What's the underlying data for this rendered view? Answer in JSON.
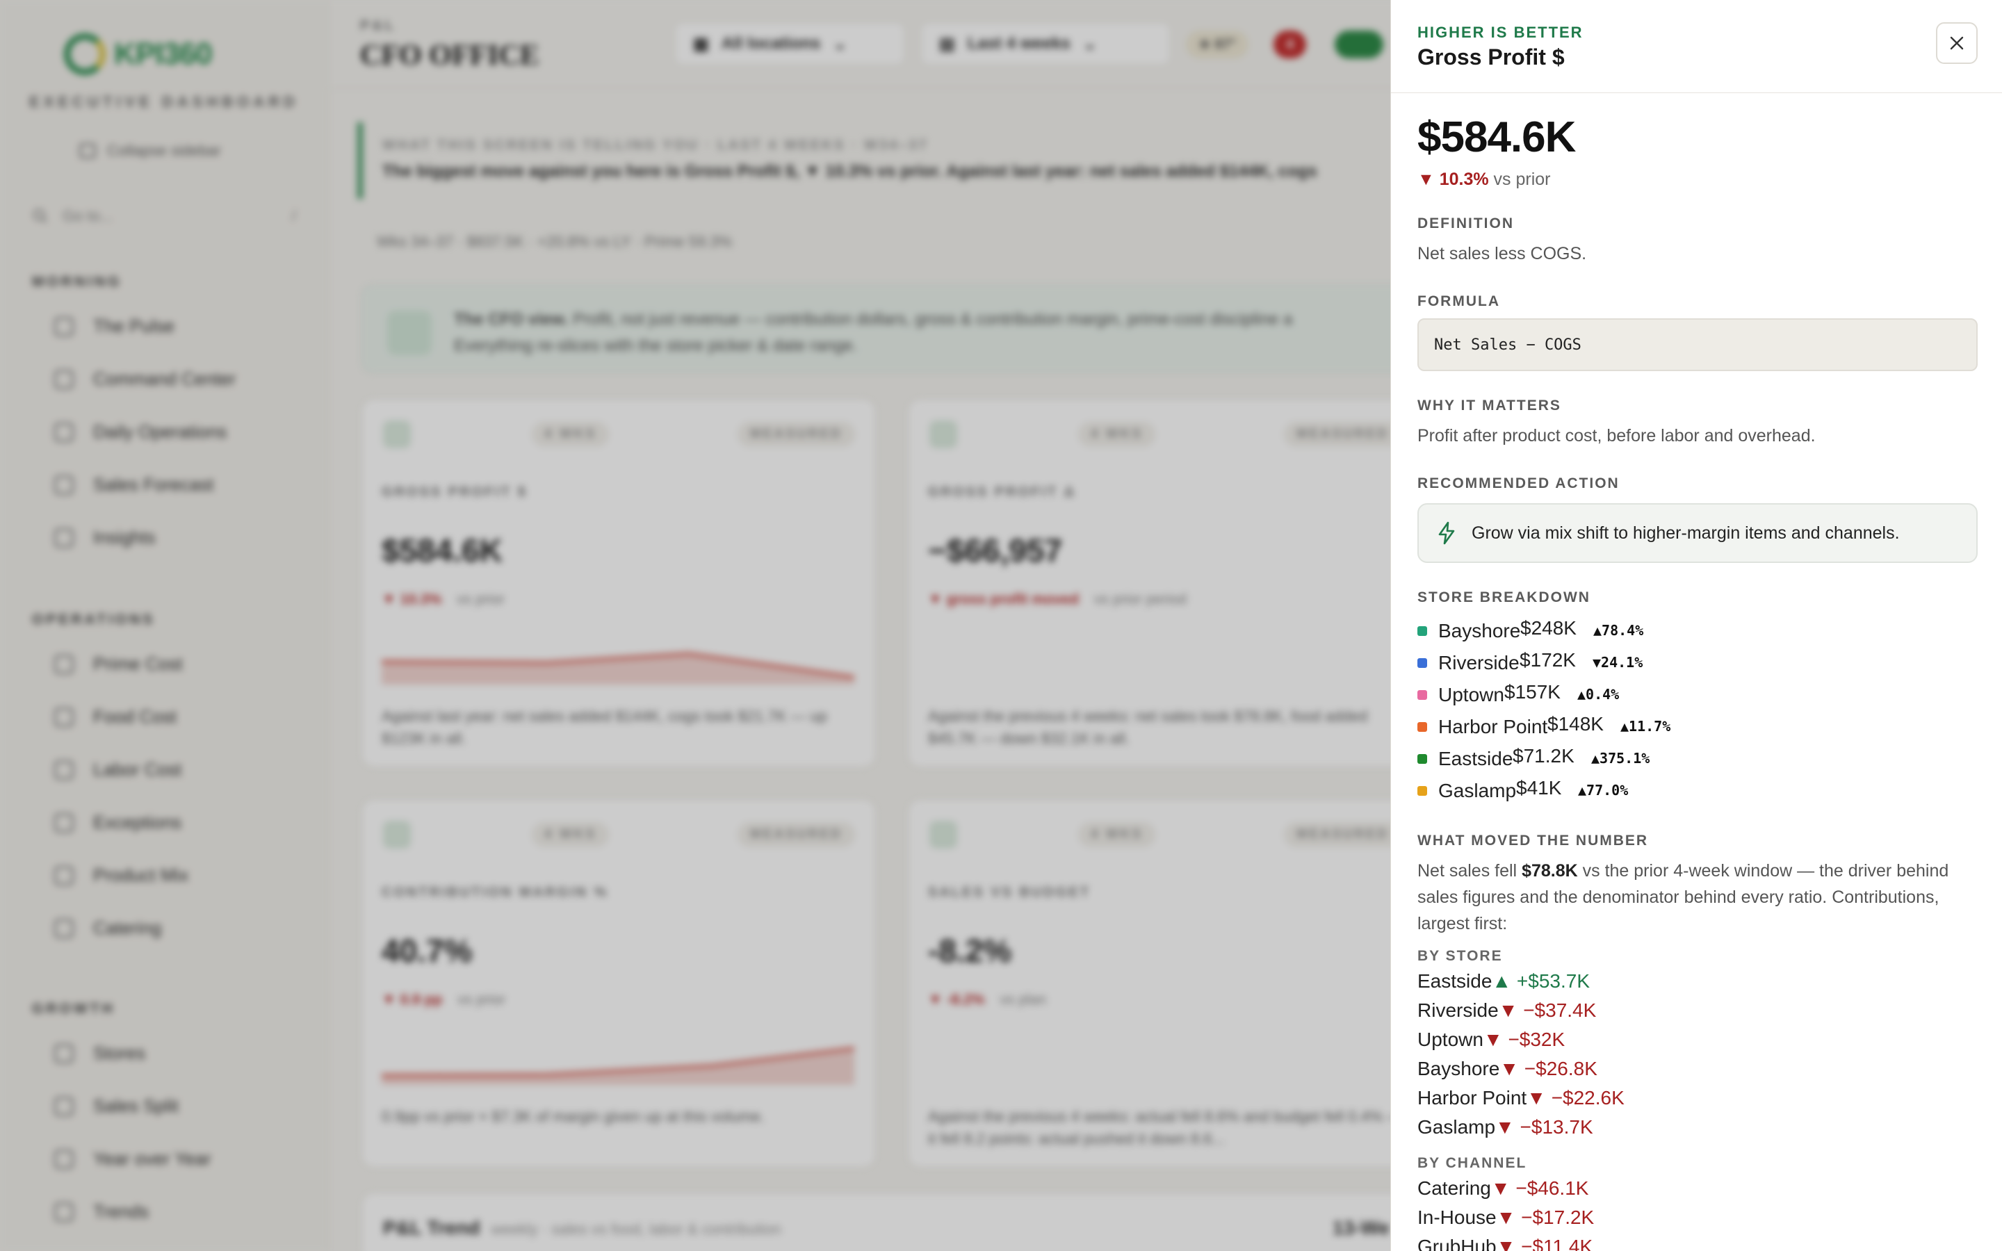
{
  "app": {
    "logo_text": "KPI360",
    "logo_sub": "EXECUTIVE DASHBOARD",
    "collapse_label": "Collapse sidebar",
    "goto_placeholder": "Go to...",
    "goto_shortcut": "/",
    "sections": [
      {
        "label": "MORNING",
        "items": [
          "The Pulse",
          "Command Center",
          "Daily Operations",
          "Sales Forecast",
          "Insights"
        ]
      },
      {
        "label": "OPERATIONS",
        "items": [
          "Prime Cost",
          "Food Cost",
          "Labor Cost",
          "Exceptions",
          "Product Mix",
          "Catering"
        ]
      },
      {
        "label": "GROWTH",
        "items": [
          "Stores",
          "Sales Split",
          "Year over Year",
          "Trends"
        ]
      }
    ],
    "breadcrumb": "P&L",
    "page_title": "CFO OFFICE",
    "location_filter": "All locations",
    "date_filter": "Last 4 weeks",
    "score_badge": "87°",
    "alert_badge": "4",
    "banner_eyebrow": "WHAT THIS SCREEN IS TELLING YOU · LAST 4 WEEKS · W34–37",
    "banner_text": "The biggest move against you here is Gross Profit $, ▼ 10.3% vs prior. Against last year: net sales added $144K, cogs",
    "stats_line": "Wks 34–37 · $837.5K · +20.8% vs LY · Prime 59.3%",
    "cfo_title": "The CFO view.",
    "cfo_text": "Profit, not just revenue — contribution dollars, gross & contribution margin, prime-cost discipline a",
    "cfo_text2": "Everything re-slices with the store picker & date range.",
    "cards": [
      {
        "period": "4 WKS",
        "status": "MEASURED",
        "label": "GROSS PROFIT $",
        "value": "$584.6K",
        "change": "▼ 10.3%",
        "change_suffix": "vs prior",
        "note": "Against last year: net sales added $144K, cogs took $21.7K — up $123K in all."
      },
      {
        "period": "4 WKS",
        "status": "MEASURED",
        "label": "GROSS PROFIT Δ",
        "value": "−$66,957",
        "change": "▼ gross profit moved",
        "change_suffix": "vs prior period",
        "note": "Against the previous 4 weeks: net sales took $78.8K, food added $45.7K — down $32.1K in all."
      },
      {
        "period": "4 WKS",
        "status": "MEASURED",
        "label": "CONTRIBUTION MARGIN %",
        "value": "40.7%",
        "change": "▼ 0.9 pp",
        "change_suffix": "vs prior",
        "note": "0.9pp vs prior × $7.3K of margin given up at this volume."
      },
      {
        "period": "4 WKS",
        "status": "MEASURED",
        "label": "SALES VS BUDGET",
        "value": "-8.2%",
        "change": "▼ -8.2%",
        "change_suffix": "vs plan",
        "note": "Against the previous 4 weeks: actual fell 8.6% and budget fell 0.4% — it fell 8.2 points: actual pushed it down 8.6..."
      }
    ],
    "pl_trend_title": "P&L Trend",
    "pl_trend_sub": "weekly · sales vs food, labor & contribution",
    "side_card_title": "13-We"
  },
  "panel": {
    "eyebrow": "HIGHER IS BETTER",
    "title": "Gross Profit $",
    "value": "$584.6K",
    "delta_value": "▼ 10.3%",
    "delta_suffix": "vs prior",
    "definition_label": "DEFINITION",
    "definition": "Net sales less COGS.",
    "formula_label": "FORMULA",
    "formula": "Net Sales − COGS",
    "why_label": "WHY IT MATTERS",
    "why": "Profit after product cost, before labor and overhead.",
    "action_label": "RECOMMENDED ACTION",
    "action": "Grow via mix shift to higher-margin items and channels.",
    "breakdown_label": "STORE BREAKDOWN",
    "stores": [
      {
        "name": "Bayshore",
        "value": "$248K",
        "change": "▲78.4%",
        "color": "#23a37a"
      },
      {
        "name": "Riverside",
        "value": "$172K",
        "change": "▼24.1%",
        "color": "#3a6fd8"
      },
      {
        "name": "Uptown",
        "value": "$157K",
        "change": "▲0.4%",
        "color": "#e86aa0"
      },
      {
        "name": "Harbor Point",
        "value": "$148K",
        "change": "▲11.7%",
        "color": "#e8672a"
      },
      {
        "name": "Eastside",
        "value": "$71.2K",
        "change": "▲375.1%",
        "color": "#1f8a2e"
      },
      {
        "name": "Gaslamp",
        "value": "$41K",
        "change": "▲77.0%",
        "color": "#e6a21a"
      }
    ],
    "moved_label": "WHAT MOVED THE NUMBER",
    "moved_pre": "Net sales fell ",
    "moved_bold": "$78.8K",
    "moved_post": " vs the prior 4-week window — the driver behind sales figures and the denominator behind every ratio. Contributions, largest first:",
    "by_store_label": "BY STORE",
    "by_store": [
      {
        "name": "Eastside",
        "arrow": "▲",
        "amount": "+$53.7K",
        "dir": "up"
      },
      {
        "name": "Riverside",
        "arrow": "▼",
        "amount": "−$37.4K",
        "dir": "dn"
      },
      {
        "name": "Uptown",
        "arrow": "▼",
        "amount": "−$32K",
        "dir": "dn"
      },
      {
        "name": "Bayshore",
        "arrow": "▼",
        "amount": "−$26.8K",
        "dir": "dn"
      },
      {
        "name": "Harbor Point",
        "arrow": "▼",
        "amount": "−$22.6K",
        "dir": "dn"
      },
      {
        "name": "Gaslamp",
        "arrow": "▼",
        "amount": "−$13.7K",
        "dir": "dn"
      }
    ],
    "by_channel_label": "BY CHANNEL",
    "by_channel": [
      {
        "name": "Catering",
        "arrow": "▼",
        "amount": "−$46.1K",
        "dir": "dn"
      },
      {
        "name": "In-House",
        "arrow": "▼",
        "amount": "−$17.2K",
        "dir": "dn"
      },
      {
        "name": "GrubHub",
        "arrow": "▼",
        "amount": "−$11.4K",
        "dir": "dn"
      }
    ]
  }
}
